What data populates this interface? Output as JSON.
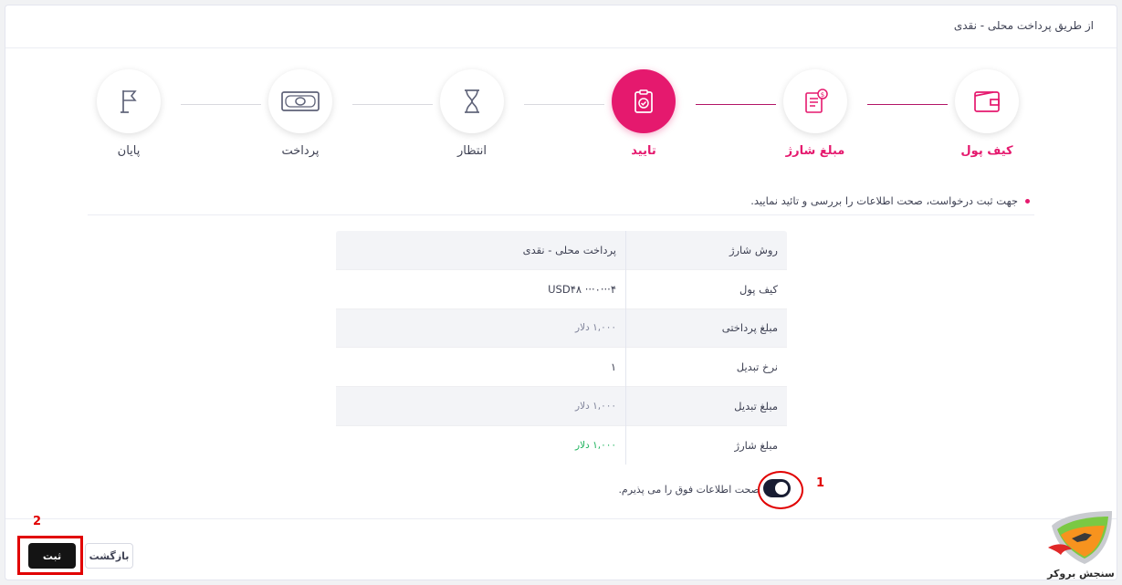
{
  "header": {
    "title": "از طریق پرداخت محلی - نقدی"
  },
  "stepper": {
    "steps": [
      {
        "label": "کیف پول",
        "icon": "wallet-icon",
        "state": "done"
      },
      {
        "label": "مبلغ شارژ",
        "icon": "invoice-dollar-icon",
        "state": "done"
      },
      {
        "label": "تایید",
        "icon": "clipboard-check-icon",
        "state": "current"
      },
      {
        "label": "انتظار",
        "icon": "hourglass-icon",
        "state": "pending"
      },
      {
        "label": "پرداخت",
        "icon": "banknote-icon",
        "state": "pending"
      },
      {
        "label": "پایان",
        "icon": "flag-icon",
        "state": "pending"
      }
    ]
  },
  "info": {
    "text": "جهت ثبت درخواست، صحت اطلاعات را بررسی و تائید نمایید."
  },
  "summary": {
    "rows": [
      {
        "label": "روش شارژ",
        "value": "پرداخت محلی - نقدی"
      },
      {
        "label": "کیف پول",
        "value": "USD۴۸ ···۰···۴"
      },
      {
        "label": "مبلغ پرداختی",
        "value": "۱,۰۰۰ دلار"
      },
      {
        "label": "نرخ تبدیل",
        "value": "۱"
      },
      {
        "label": "مبلغ تبدیل",
        "value": "۱,۰۰۰ دلار"
      },
      {
        "label": "مبلغ شارژ",
        "value": "۱,۰۰۰ دلار"
      }
    ]
  },
  "agreement": {
    "text": "صحت اطلاعات فوق را می پذیرم.",
    "checked": true
  },
  "annotations": {
    "one": "1",
    "two": "2"
  },
  "buttons": {
    "submit": "ثبت",
    "back": "بازگشت"
  },
  "logo": {
    "text": "سنجش بروکر"
  },
  "colors": {
    "accent": "#e5196e",
    "annotation": "#e10000",
    "positive": "#1bb35b",
    "dark_button": "#141414"
  }
}
